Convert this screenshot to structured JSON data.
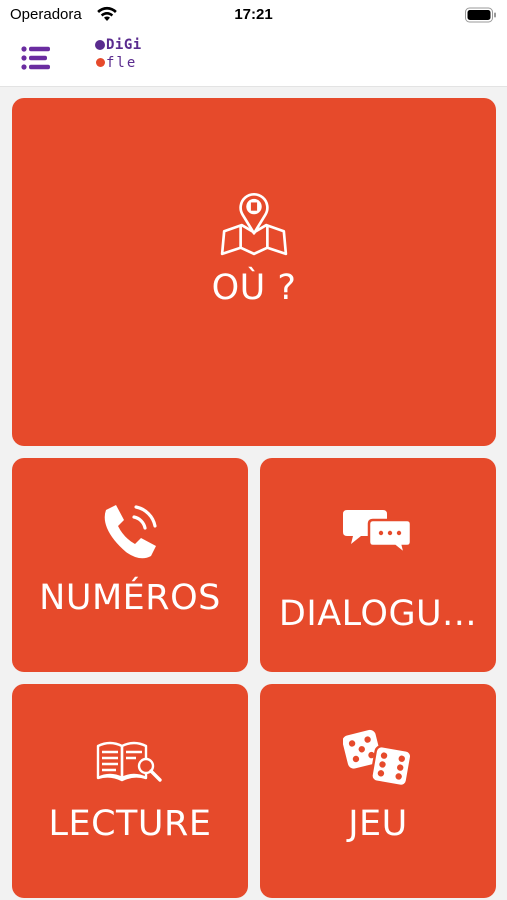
{
  "status": {
    "carrier": "Operadora",
    "time": "17:21"
  },
  "app": {
    "logo_line1": "DiGi",
    "logo_line2": "fle"
  },
  "tiles": [
    {
      "label": "OÙ ?",
      "icon": "map-pin-icon"
    },
    {
      "label": "NUMÉROS",
      "icon": "phone-icon"
    },
    {
      "label": "DIALOGU...",
      "icon": "chat-bubbles-icon"
    },
    {
      "label": "LECTURE",
      "icon": "book-search-icon"
    },
    {
      "label": "JEU",
      "icon": "dice-icon"
    }
  ],
  "colors": {
    "tile": "#e64a2b",
    "brand": "#5a2b8e",
    "menu": "#6a2ca0"
  }
}
